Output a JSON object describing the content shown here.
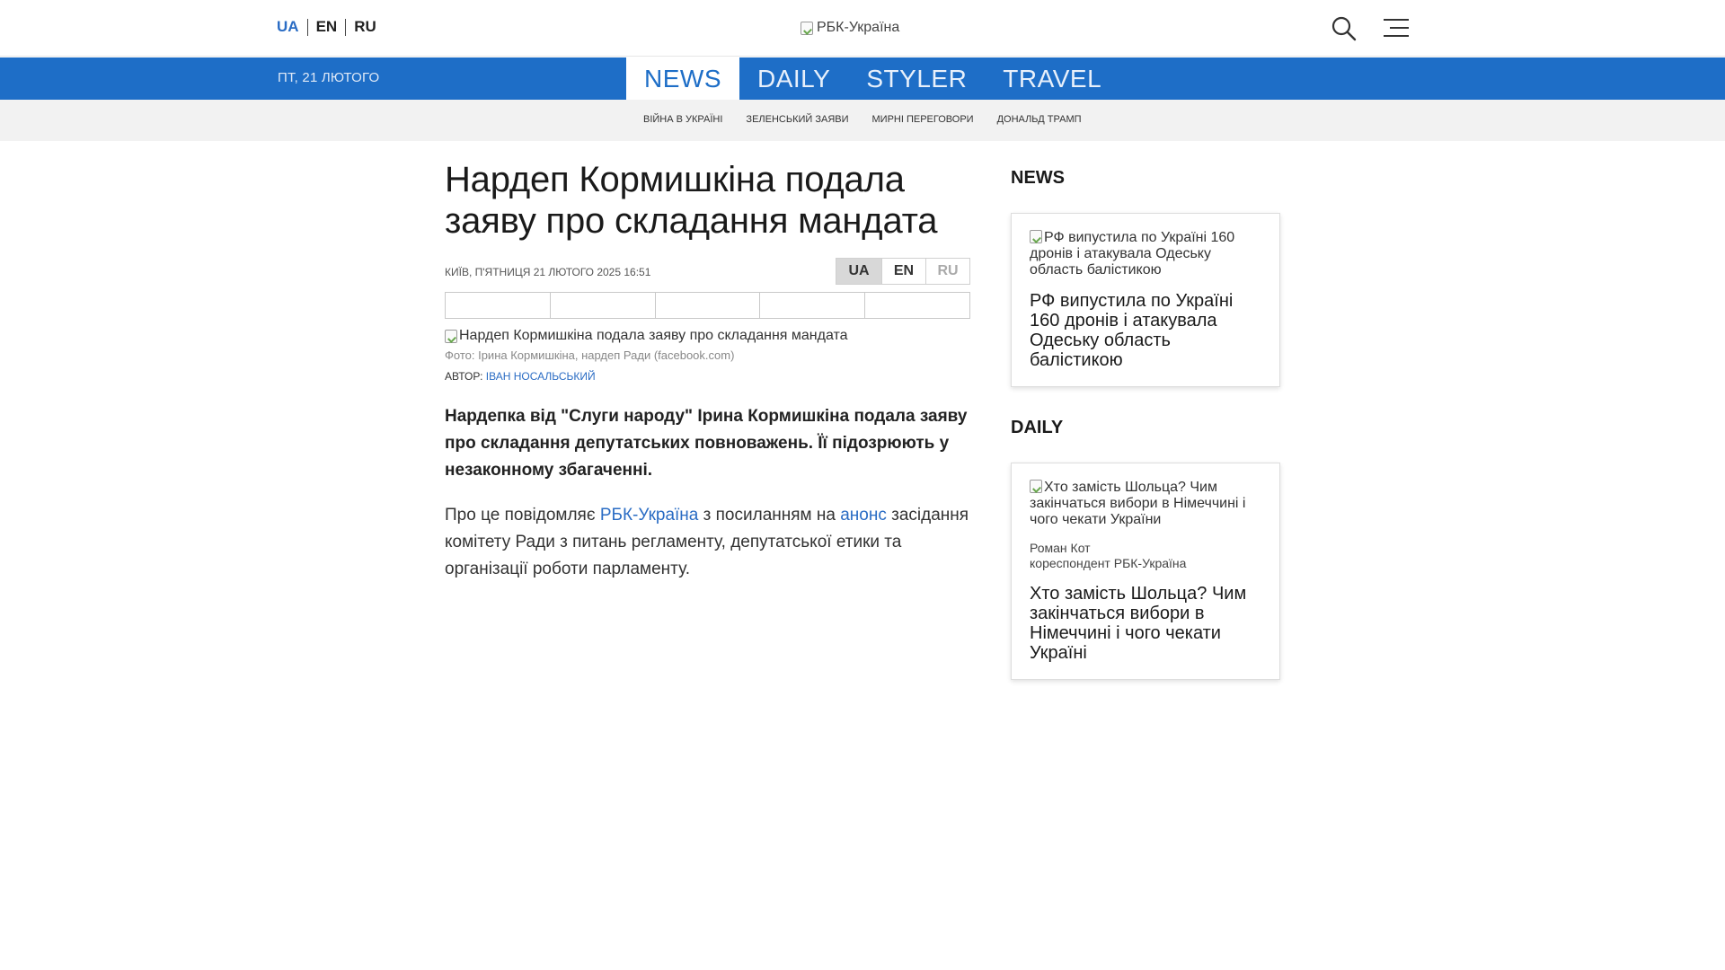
{
  "header": {
    "languages": [
      {
        "label": "UA",
        "active": true
      },
      {
        "label": "EN",
        "active": false
      },
      {
        "label": "RU",
        "active": false
      }
    ],
    "logo_alt": "РБК-Україна",
    "search_icon": "search-icon",
    "menu_icon": "menu-icon"
  },
  "nav": {
    "date": "ПТ, 21 ЛЮТОГО",
    "sections": [
      "NEWS",
      "DAILY",
      "STYLER",
      "TRAVEL"
    ],
    "active_section": "NEWS"
  },
  "tags": [
    "ВІЙНА В УКРАЇНІ",
    "ЗЕЛЕНСЬКИЙ ЗАЯВИ",
    "МИРНІ ПЕРЕГОВОРИ",
    "ДОНАЛЬД ТРАМП"
  ],
  "article": {
    "title": "Нардеп Кормишкіна подала заяву про складання мандата",
    "published": "КИЇВ, П'ЯТНИЦЯ 21 ЛЮТОГО 2025 16:51",
    "lang_switch": [
      "UA",
      "EN",
      "RU"
    ],
    "photo_alt": "Нардеп Кормишкіна подала заяву про складання мандата",
    "photo_caption": "Фото: Ірина Кормишкіна, нардеп Ради (facebook.com)",
    "author_label": "АВТОР:",
    "author_name": "ІВАН НОСАЛЬСЬКИЙ",
    "lead": "Нардепка від \"Слуги народу\" Ірина Кормишкіна подала заяву про складання депутатських повноважень. Її підозрюють у незаконному збагаченні.",
    "body_part1": "Про це повідомляє ",
    "body_link1": "РБК-Україна",
    "body_part2": " з посиланням на ",
    "body_link2": "анонс",
    "body_part3": " засідання комітету Ради з питань регламенту, депутатської етики та організації роботи парламенту."
  },
  "sidebar": {
    "news_heading": "NEWS",
    "news_card": {
      "image_alt": "РФ випустила по Україні 160 дронів і атакувала Одеську область балістикою",
      "title": "РФ випустила по Україні 160 дронів і атакувала Одеську область балістикою"
    },
    "daily_heading": "DAILY",
    "daily_card": {
      "image_alt": "Хто замість Шольца? Чим закінчаться вибори в Німеччині і чого чекати України",
      "author_name": "Роман Кот",
      "author_role": "кореспондент РБК-Україна",
      "title": "Хто замість Шольца? Чим закінчаться вибори в Німеччині і чого чекати Україні"
    }
  }
}
